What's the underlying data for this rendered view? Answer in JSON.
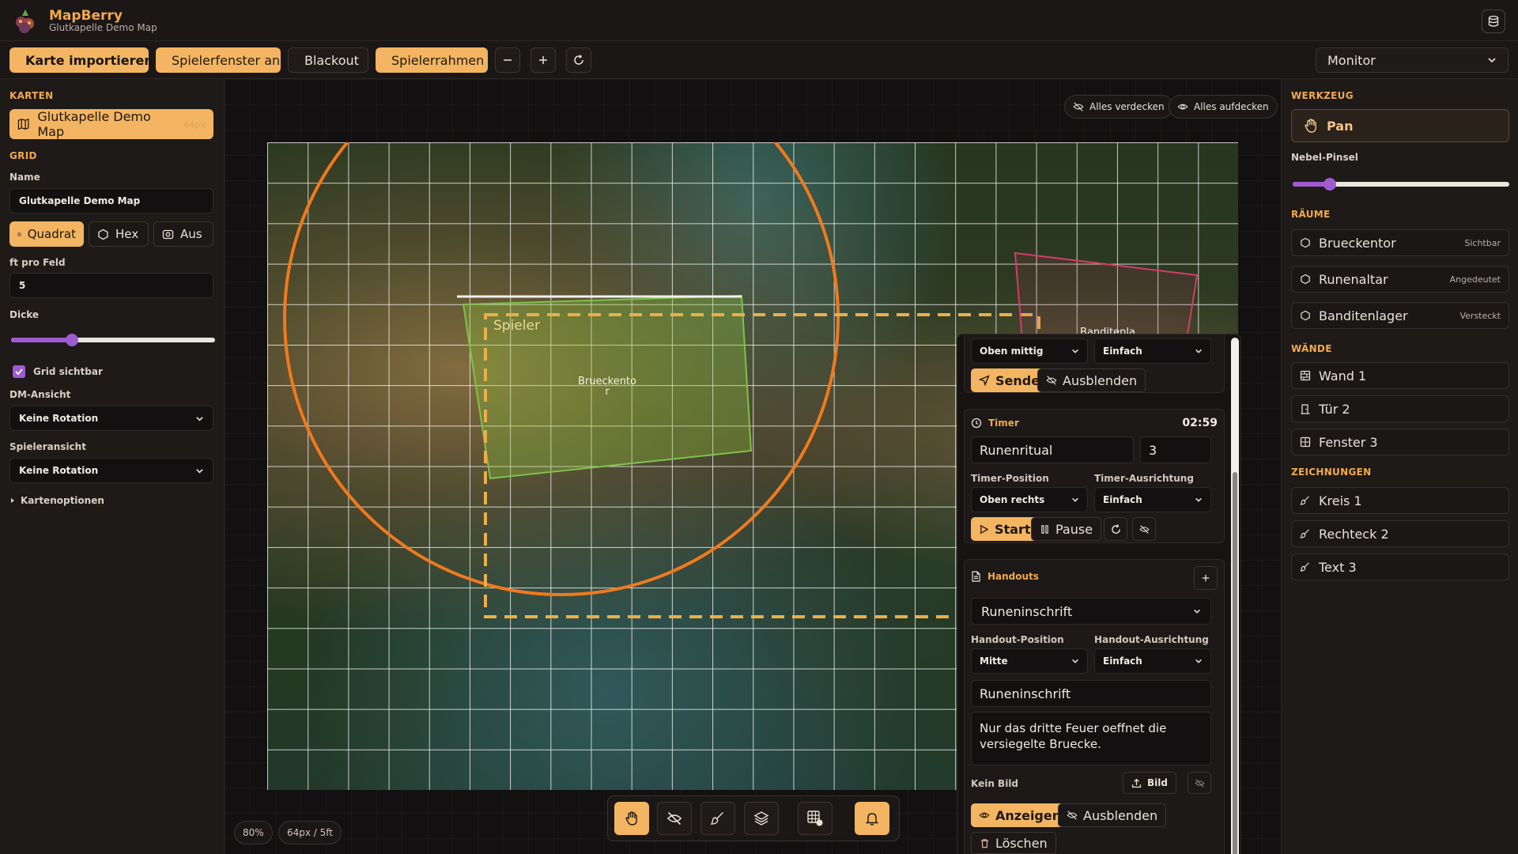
{
  "app": {
    "name": "MapBerry",
    "subtitle": "Glutkapelle Demo Map"
  },
  "toolbar": {
    "import_label": "Karte importieren",
    "player_window_label": "Spielerfenster an",
    "blackout_label": "Blackout",
    "player_frame_label": "Spielerrahmen",
    "monitor_value": "Monitor"
  },
  "left": {
    "maps_title": "KARTEN",
    "active_map": "Glutkapelle Demo Map",
    "active_map_res": "64px",
    "grid_title": "GRID",
    "name_label": "Name",
    "name_value": "Glutkapelle Demo Map",
    "grid_modes": [
      "Quadrat",
      "Hex",
      "Aus"
    ],
    "ft_label": "ft pro Feld",
    "ft_value": "5",
    "thickness_label": "Dicke",
    "thickness_value": 0.3,
    "grid_visible_label": "Grid sichtbar",
    "dm_view_label": "DM-Ansicht",
    "dm_view_value": "Keine Rotation",
    "player_view_label": "Spieleransicht",
    "player_view_value": "Keine Rotation",
    "map_options_label": "Kartenoptionen"
  },
  "canvas": {
    "hide_all": "Alles verdecken",
    "reveal_all": "Alles aufdecken",
    "player_label": "Spieler",
    "room_label_1": "Brueckento\nr",
    "room_label_2": "Banditenla\nger",
    "zoom": "80%",
    "scale": "64px / 5ft"
  },
  "panel": {
    "pos_value_top": "Oben mittig",
    "align_value_top": "Einfach",
    "send_label": "Senden",
    "hide_label": "Ausblenden",
    "timer_title": "Timer",
    "timer_time": "02:59",
    "timer_name": "Runenritual",
    "timer_minutes": "3",
    "timer_pos_label": "Timer-Position",
    "timer_align_label": "Timer-Ausrichtung",
    "timer_pos_value": "Oben rechts",
    "timer_align_value": "Einfach",
    "start_label": "Start",
    "pause_label": "Pause",
    "handouts_title": "Handouts",
    "handout_select": "Runeninschrift",
    "handout_pos_label": "Handout-Position",
    "handout_align_label": "Handout-Ausrichtung",
    "handout_pos_value": "Mitte",
    "handout_align_value": "Einfach",
    "handout_title": "Runeninschrift",
    "handout_text": "Nur das dritte Feuer oeffnet die versiegelte Bruecke.",
    "no_image": "Kein Bild",
    "image_label": "Bild",
    "show_label": "Anzeigen",
    "hide2_label": "Ausblenden",
    "delete_label": "Löschen"
  },
  "right": {
    "tool_title": "WERKZEUG",
    "pan_label": "Pan",
    "fog_label": "Nebel-Pinsel",
    "fog_value": 0.17,
    "rooms_title": "RÄUME",
    "rooms": [
      {
        "name": "Brueckentor",
        "tag": "Sichtbar"
      },
      {
        "name": "Runenaltar",
        "tag": "Angedeutet"
      },
      {
        "name": "Banditenlager",
        "tag": "Versteckt"
      }
    ],
    "walls_title": "WÄNDE",
    "walls": [
      "Wand 1",
      "Tür 2",
      "Fenster 3"
    ],
    "drawings_title": "ZEICHNUNGEN",
    "drawings": [
      "Kreis 1",
      "Rechteck 2",
      "Text 3"
    ]
  },
  "colors": {
    "accent": "#f3b561",
    "accent_text": "#f3a94a",
    "slider": "#a05ad0",
    "circle": "#f07a1e",
    "player_frame": "#e8b04a",
    "room_green": "#7fc24a",
    "room_red": "#d83a6a"
  }
}
